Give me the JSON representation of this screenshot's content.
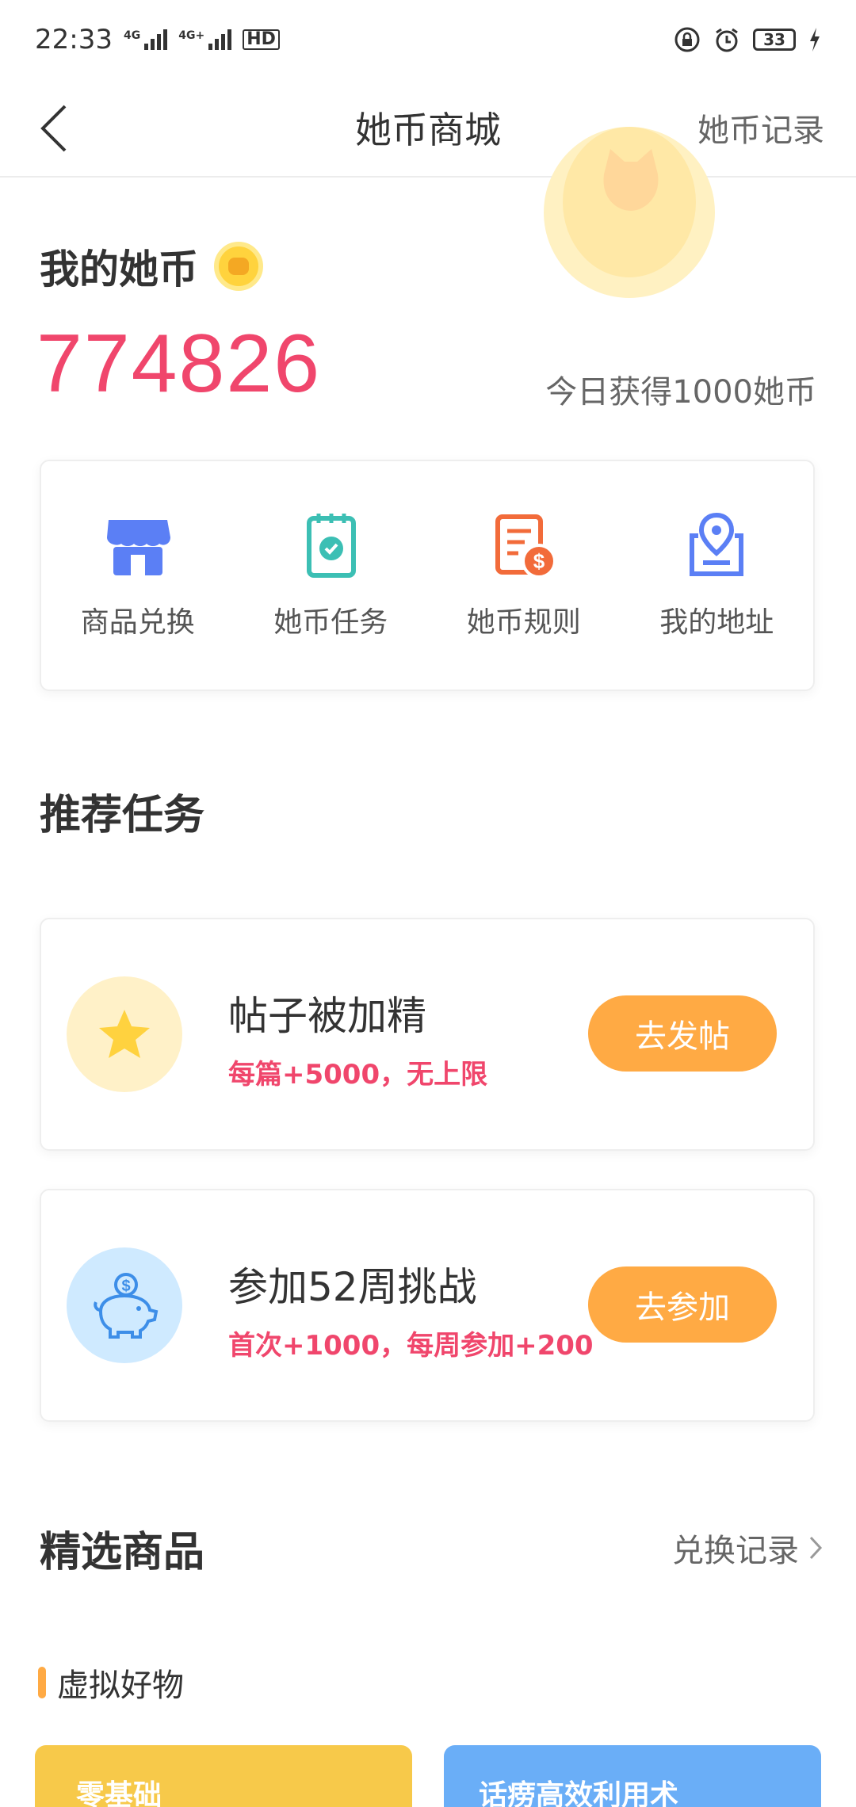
{
  "status_bar": {
    "time": "22:33",
    "net1": "4G",
    "net2": "4G+",
    "hd": "HD",
    "battery": "33"
  },
  "nav": {
    "title": "她币商城",
    "right_link": "她币记录"
  },
  "coin_header": {
    "label": "我的她币",
    "balance": "774826",
    "today": "今日获得1000她币"
  },
  "menu": [
    {
      "label": "商品兑换",
      "icon": "store-icon"
    },
    {
      "label": "她币任务",
      "icon": "task-checklist-icon"
    },
    {
      "label": "她币规则",
      "icon": "rules-document-icon"
    },
    {
      "label": "我的地址",
      "icon": "address-location-icon"
    }
  ],
  "recommended": {
    "title": "推荐任务",
    "tasks": [
      {
        "title": "帖子被加精",
        "desc": "每篇+5000，无上限",
        "button": "去发帖",
        "icon": "star-icon",
        "icon_bg": "#fff1c8"
      },
      {
        "title": "参加52周挑战",
        "desc": "首次+1000，每周参加+200",
        "button": "去参加",
        "icon": "piggy-bank-icon",
        "icon_bg": "#cfeaff"
      }
    ]
  },
  "featured": {
    "title": "精选商品",
    "link": "兑换记录",
    "sub_title": "虚拟好物",
    "products": [
      {
        "text": "零基础",
        "color": "#f7c94a"
      },
      {
        "text": "话痨高效利用术",
        "color": "#6aaef7"
      }
    ]
  },
  "colors": {
    "accent": "#f0466c",
    "button": "#ffaa44",
    "icon_blue": "#5b7ff5",
    "icon_teal": "#3cbfb4",
    "icon_orange": "#f26b3a"
  }
}
